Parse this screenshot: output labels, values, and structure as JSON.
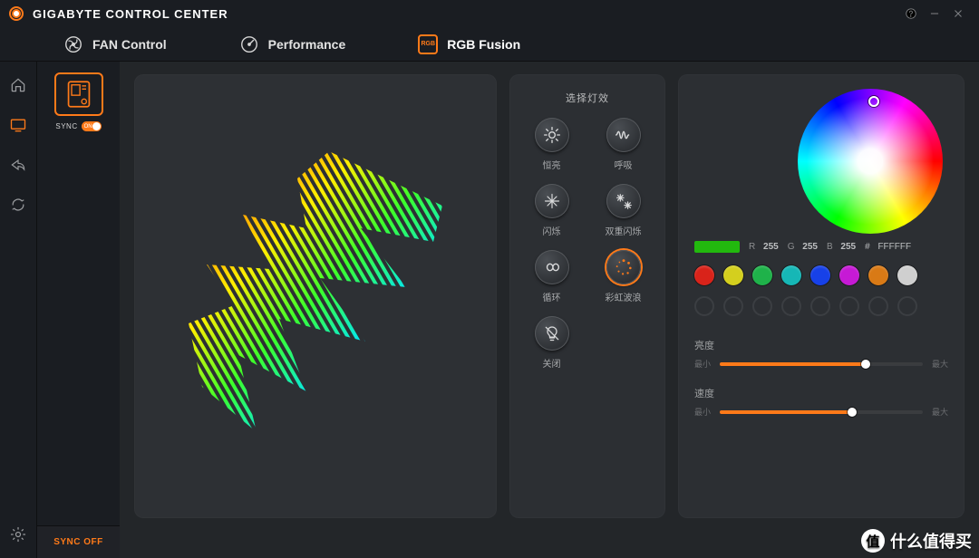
{
  "app": {
    "title": "GIGABYTE CONTROL CENTER"
  },
  "tabs": {
    "fan": {
      "label": "FAN Control"
    },
    "performance": {
      "label": "Performance"
    },
    "rgb": {
      "label": "RGB Fusion"
    }
  },
  "device_column": {
    "sync_label": "SYNC",
    "sync_toggle_text": "ON",
    "sync_off_button": "SYNC OFF"
  },
  "effects": {
    "title": "选择灯效",
    "items": {
      "static": {
        "label": "恒亮"
      },
      "breathing": {
        "label": "呼吸"
      },
      "flash": {
        "label": "闪烁"
      },
      "double_flash": {
        "label": "双重闪烁"
      },
      "cycle": {
        "label": "循环"
      },
      "rainbow_wave": {
        "label": "彩虹波浪"
      },
      "off": {
        "label": "关闭"
      }
    },
    "active": "rainbow_wave"
  },
  "color_panel": {
    "rgb_labels": {
      "r": "R",
      "g": "G",
      "b": "B",
      "hash": "#"
    },
    "rgb": {
      "r": "255",
      "g": "255",
      "b": "255"
    },
    "hex": "FFFFFF",
    "current_swatch": "#22b90e",
    "presets": [
      "#d9231a",
      "#d4cf1e",
      "#1fb24a",
      "#16b7b6",
      "#1741e8",
      "#c61ad5",
      "#d97a16",
      "#cfcfcf"
    ],
    "sliders": {
      "brightness": {
        "label": "亮度",
        "min_label": "最小",
        "max_label": "最大",
        "value_pct": 72
      },
      "speed": {
        "label": "速度",
        "min_label": "最小",
        "max_label": "最大",
        "value_pct": 65
      }
    }
  },
  "watermark": {
    "badge": "值",
    "text": "什么值得买"
  }
}
